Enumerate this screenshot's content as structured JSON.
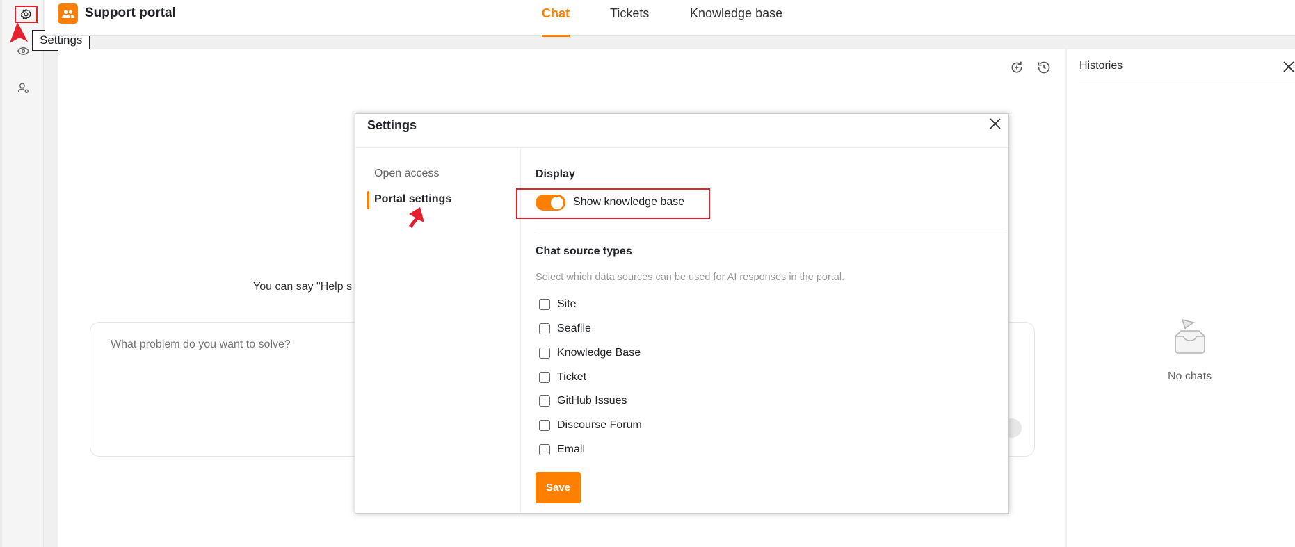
{
  "app": {
    "title": "Support portal",
    "accent_color": "#ff8000",
    "highlight_color": "#e5202f"
  },
  "rail": {
    "items": [
      {
        "icon": "gear-icon",
        "label": "Settings"
      },
      {
        "icon": "eye-icon"
      },
      {
        "icon": "user-settings-icon"
      }
    ],
    "tooltip": "Settings"
  },
  "header": {
    "tabs": [
      {
        "label": "Chat",
        "active": true
      },
      {
        "label": "Tickets"
      },
      {
        "label": "Knowledge base"
      }
    ]
  },
  "chat": {
    "hint": "You can say \"Help s",
    "input_placeholder": "What problem do you want to solve?"
  },
  "histories": {
    "title": "Histories",
    "empty_text": "No chats"
  },
  "modal": {
    "title": "Settings",
    "nav": [
      {
        "label": "Open access"
      },
      {
        "label": "Portal settings",
        "active": true
      }
    ],
    "display": {
      "section_title": "Display",
      "toggle_label": "Show knowledge base",
      "toggle_on": true
    },
    "sources": {
      "section_title": "Chat source types",
      "description": "Select which data sources can be used for AI responses in the portal.",
      "options": [
        {
          "label": "Site",
          "checked": false
        },
        {
          "label": "Seafile",
          "checked": false
        },
        {
          "label": "Knowledge Base",
          "checked": false
        },
        {
          "label": "Ticket",
          "checked": false
        },
        {
          "label": "GitHub Issues",
          "checked": false
        },
        {
          "label": "Discourse Forum",
          "checked": false
        },
        {
          "label": "Email",
          "checked": false
        }
      ]
    },
    "save_label": "Save"
  }
}
